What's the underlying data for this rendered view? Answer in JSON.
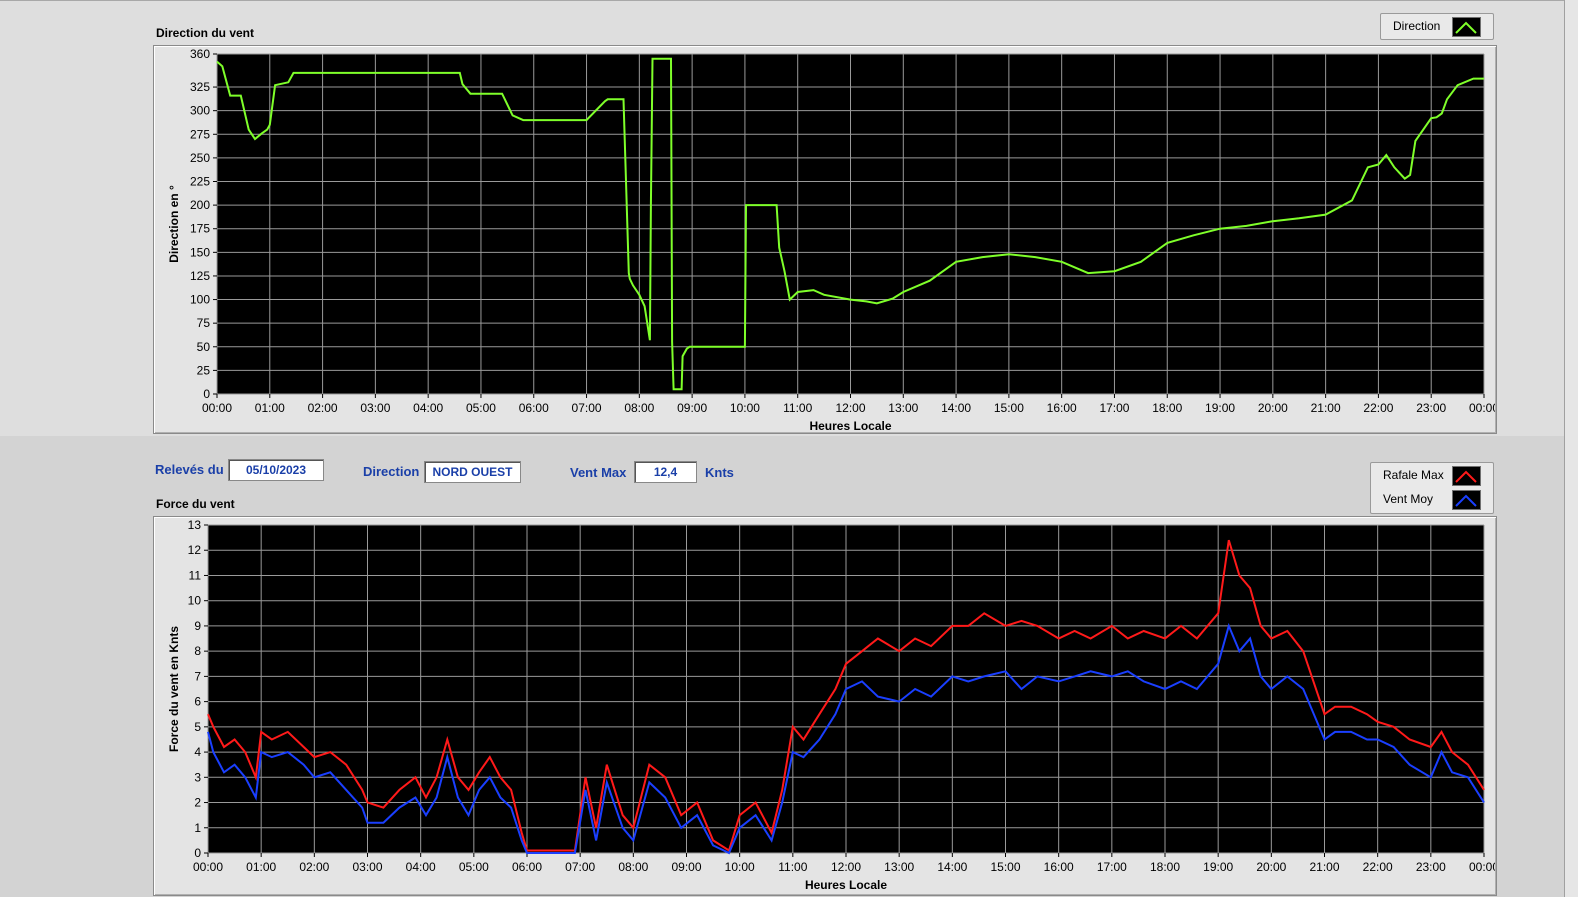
{
  "direction_chart": {
    "title": "Direction du vent",
    "ylabel": "Direction en °",
    "xlabel": "Heures Locale",
    "legend": [
      {
        "name": "Direction",
        "color": "#7fff2a"
      }
    ]
  },
  "info_bar": {
    "releves_label": "Relevés du",
    "date_value": "05/10/2023",
    "direction_label": "Direction",
    "direction_value": "NORD OUEST",
    "ventmax_label": "Vent Max",
    "ventmax_value": "12,4",
    "unit_label": "Knts"
  },
  "force_chart": {
    "title": "Force du vent",
    "ylabel": "Force du vent en Knts",
    "xlabel": "Heures Locale",
    "legend": [
      {
        "name": "Rafale Max",
        "color": "#ff1a1a"
      },
      {
        "name": "Vent Moy",
        "color": "#1a3fff"
      }
    ]
  },
  "chart_data": [
    {
      "type": "line",
      "title": "Direction du vent",
      "xlabel": "Heures Locale",
      "ylabel": "Direction en °",
      "xlim": [
        0,
        24
      ],
      "ylim": [
        0,
        360
      ],
      "yticks": [
        0,
        25,
        50,
        75,
        100,
        125,
        150,
        175,
        200,
        225,
        250,
        275,
        300,
        325,
        360
      ],
      "xticks": [
        "00:00",
        "01:00",
        "02:00",
        "03:00",
        "04:00",
        "05:00",
        "06:00",
        "07:00",
        "08:00",
        "09:00",
        "10:00",
        "11:00",
        "12:00",
        "13:00",
        "14:00",
        "15:00",
        "16:00",
        "17:00",
        "18:00",
        "19:00",
        "20:00",
        "21:00",
        "22:00",
        "23:00",
        "00:00"
      ],
      "grid": true,
      "series": [
        {
          "name": "Direction",
          "color": "#7fff2a",
          "x": [
            0,
            0.1,
            0.25,
            0.45,
            0.6,
            0.72,
            0.85,
            0.95,
            1.0,
            1.1,
            1.35,
            1.45,
            2.0,
            3.0,
            4.0,
            4.6,
            4.65,
            4.8,
            5.0,
            5.4,
            5.6,
            5.8,
            6.0,
            7.0,
            7.35,
            7.4,
            7.7,
            7.8,
            7.82,
            7.88,
            8.0,
            8.1,
            8.2,
            8.22,
            8.25,
            8.3,
            8.35,
            8.5,
            8.6,
            8.62,
            8.65,
            8.7,
            8.72,
            8.8,
            8.82,
            8.9,
            8.95,
            9.1,
            10.0,
            10.02,
            10.15,
            10.55,
            10.6,
            10.65,
            10.75,
            10.85,
            11.0,
            11.3,
            11.5,
            12.0,
            12.3,
            12.5,
            12.8,
            13.0,
            13.5,
            14.0,
            14.5,
            15.0,
            15.5,
            16.0,
            16.5,
            17.0,
            17.5,
            18.0,
            18.5,
            19.0,
            19.5,
            20.0,
            20.5,
            21.0,
            21.5,
            21.8,
            22.0,
            22.15,
            22.3,
            22.5,
            22.6,
            22.7,
            23.0,
            23.1,
            23.2,
            23.3,
            23.5,
            23.8,
            24.0
          ],
          "y": [
            352,
            347,
            316,
            316,
            280,
            270,
            276,
            280,
            285,
            327,
            330,
            340,
            340,
            340,
            340,
            340,
            328,
            318,
            318,
            318,
            295,
            290,
            290,
            290,
            310,
            312,
            312,
            128,
            122,
            115,
            105,
            93,
            57,
            200,
            355,
            355,
            355,
            355,
            355,
            55,
            5,
            5,
            5,
            5,
            40,
            48,
            50,
            50,
            50,
            200,
            200,
            200,
            200,
            155,
            130,
            100,
            108,
            110,
            105,
            100,
            98,
            96,
            101,
            108,
            120,
            140,
            145,
            148,
            145,
            140,
            128,
            130,
            140,
            160,
            168,
            175,
            178,
            183,
            186,
            190,
            205,
            240,
            243,
            253,
            240,
            228,
            232,
            268,
            292,
            293,
            297,
            312,
            327,
            334,
            334
          ]
        }
      ]
    },
    {
      "type": "line",
      "title": "Force du vent",
      "xlabel": "Heures Locale",
      "ylabel": "Force du vent en Knts",
      "xlim": [
        0,
        24
      ],
      "ylim": [
        0,
        13
      ],
      "yticks": [
        0,
        1,
        2,
        3,
        4,
        5,
        6,
        7,
        8,
        9,
        10,
        11,
        12,
        13
      ],
      "xticks": [
        "00:00",
        "01:00",
        "02:00",
        "03:00",
        "04:00",
        "05:00",
        "06:00",
        "07:00",
        "08:00",
        "09:00",
        "10:00",
        "11:00",
        "12:00",
        "13:00",
        "14:00",
        "15:00",
        "16:00",
        "17:00",
        "18:00",
        "19:00",
        "20:00",
        "21:00",
        "22:00",
        "23:00",
        "00:00"
      ],
      "grid": true,
      "series": [
        {
          "name": "Rafale Max",
          "color": "#ff1a1a",
          "x": [
            0,
            0.1,
            0.3,
            0.5,
            0.7,
            0.9,
            1.0,
            1.2,
            1.5,
            1.8,
            2.0,
            2.3,
            2.6,
            2.9,
            3.0,
            3.3,
            3.6,
            3.9,
            4.1,
            4.3,
            4.5,
            4.7,
            4.9,
            5.1,
            5.3,
            5.5,
            5.7,
            5.9,
            6.0,
            6.3,
            6.6,
            6.9,
            7.1,
            7.3,
            7.5,
            7.8,
            8.0,
            8.3,
            8.6,
            8.9,
            9.2,
            9.5,
            9.8,
            10.0,
            10.3,
            10.6,
            10.8,
            11.0,
            11.2,
            11.5,
            11.8,
            12.0,
            12.3,
            12.6,
            13.0,
            13.3,
            13.6,
            14.0,
            14.3,
            14.6,
            15.0,
            15.3,
            15.6,
            16.0,
            16.3,
            16.6,
            17.0,
            17.3,
            17.6,
            18.0,
            18.3,
            18.6,
            19.0,
            19.2,
            19.4,
            19.6,
            19.8,
            20.0,
            20.3,
            20.6,
            21.0,
            21.2,
            21.5,
            21.8,
            22.0,
            22.3,
            22.6,
            23.0,
            23.2,
            23.4,
            23.7,
            24.0
          ],
          "y": [
            5.5,
            5.0,
            4.2,
            4.5,
            4.0,
            3.0,
            4.8,
            4.5,
            4.8,
            4.2,
            3.8,
            4.0,
            3.5,
            2.5,
            2.0,
            1.8,
            2.5,
            3.0,
            2.2,
            3.0,
            4.5,
            3.0,
            2.5,
            3.2,
            3.8,
            3.0,
            2.5,
            0.8,
            0.1,
            0.1,
            0.1,
            0.1,
            3.0,
            1.0,
            3.5,
            1.5,
            1.0,
            3.5,
            3.0,
            1.5,
            2.0,
            0.5,
            0.1,
            1.5,
            2.0,
            0.8,
            2.5,
            5.0,
            4.5,
            5.5,
            6.5,
            7.5,
            8.0,
            8.5,
            8.0,
            8.5,
            8.2,
            9.0,
            9.0,
            9.5,
            9.0,
            9.2,
            9.0,
            8.5,
            8.8,
            8.5,
            9.0,
            8.5,
            8.8,
            8.5,
            9.0,
            8.5,
            9.5,
            12.4,
            11.0,
            10.5,
            9.0,
            8.5,
            8.8,
            8.0,
            5.5,
            5.8,
            5.8,
            5.5,
            5.2,
            5.0,
            4.5,
            4.2,
            4.8,
            4.0,
            3.5,
            2.5
          ]
        },
        {
          "name": "Vent Moy",
          "color": "#1a3fff",
          "x": [
            0,
            0.1,
            0.3,
            0.5,
            0.7,
            0.9,
            1.0,
            1.2,
            1.5,
            1.8,
            2.0,
            2.3,
            2.6,
            2.9,
            3.0,
            3.3,
            3.6,
            3.9,
            4.1,
            4.3,
            4.5,
            4.7,
            4.9,
            5.1,
            5.3,
            5.5,
            5.7,
            5.9,
            6.0,
            6.3,
            6.6,
            6.9,
            7.1,
            7.3,
            7.5,
            7.8,
            8.0,
            8.3,
            8.6,
            8.9,
            9.2,
            9.5,
            9.8,
            10.0,
            10.3,
            10.6,
            10.8,
            11.0,
            11.2,
            11.5,
            11.8,
            12.0,
            12.3,
            12.6,
            13.0,
            13.3,
            13.6,
            14.0,
            14.3,
            14.6,
            15.0,
            15.3,
            15.6,
            16.0,
            16.3,
            16.6,
            17.0,
            17.3,
            17.6,
            18.0,
            18.3,
            18.6,
            19.0,
            19.2,
            19.4,
            19.6,
            19.8,
            20.0,
            20.3,
            20.6,
            21.0,
            21.2,
            21.5,
            21.8,
            22.0,
            22.3,
            22.6,
            23.0,
            23.2,
            23.4,
            23.7,
            24.0
          ],
          "y": [
            4.8,
            4.0,
            3.2,
            3.5,
            3.0,
            2.2,
            4.0,
            3.8,
            4.0,
            3.5,
            3.0,
            3.2,
            2.5,
            1.8,
            1.2,
            1.2,
            1.8,
            2.2,
            1.5,
            2.2,
            3.8,
            2.2,
            1.5,
            2.5,
            3.0,
            2.2,
            1.8,
            0.5,
            0.0,
            0.0,
            0.0,
            0.0,
            2.5,
            0.5,
            2.8,
            1.0,
            0.5,
            2.8,
            2.2,
            1.0,
            1.5,
            0.3,
            0.0,
            1.0,
            1.5,
            0.5,
            2.0,
            4.0,
            3.8,
            4.5,
            5.5,
            6.5,
            6.8,
            6.2,
            6.0,
            6.5,
            6.2,
            7.0,
            6.8,
            7.0,
            7.2,
            6.5,
            7.0,
            6.8,
            7.0,
            7.2,
            7.0,
            7.2,
            6.8,
            6.5,
            6.8,
            6.5,
            7.5,
            9.0,
            8.0,
            8.5,
            7.0,
            6.5,
            7.0,
            6.5,
            4.5,
            4.8,
            4.8,
            4.5,
            4.5,
            4.2,
            3.5,
            3.0,
            4.0,
            3.2,
            3.0,
            2.0
          ]
        }
      ]
    }
  ]
}
